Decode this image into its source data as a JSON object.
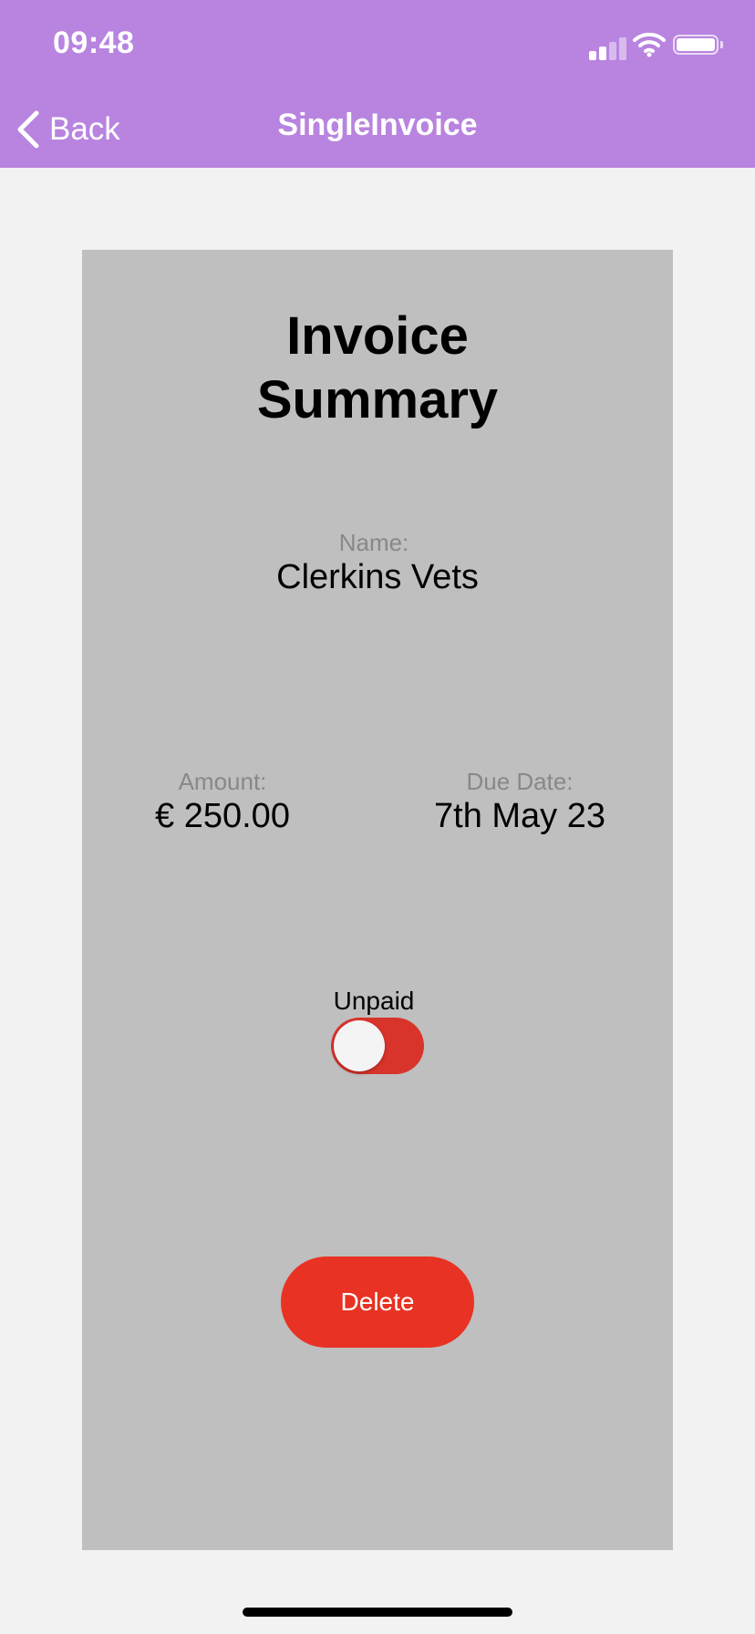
{
  "status_bar": {
    "time": "09:48",
    "icons": [
      "signal-icon",
      "wifi-icon",
      "battery-icon"
    ]
  },
  "nav": {
    "back_label": "Back",
    "title": "SingleInvoice",
    "background": "#b884df"
  },
  "invoice": {
    "heading": "Invoice Summary",
    "name_label": "Name:",
    "name_value": "Clerkins Vets",
    "amount_label": "Amount:",
    "amount_value": "€ 250.00",
    "due_label": "Due Date:",
    "due_value": "7th May 23",
    "status_label": "Unpaid",
    "paid": false,
    "toggle_color": "#d9342b",
    "delete_label": "Delete",
    "delete_color": "#e83223"
  }
}
